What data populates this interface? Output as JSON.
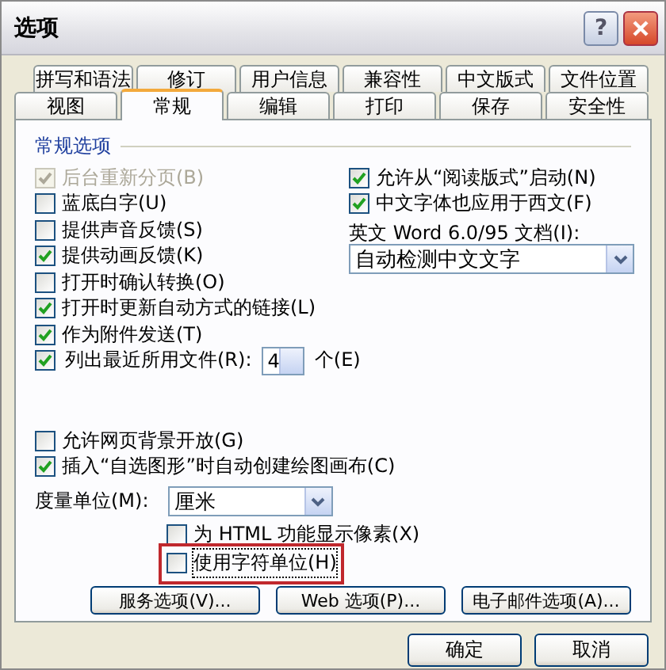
{
  "window": {
    "title": "选项",
    "help_button": "?"
  },
  "tab_rows": [
    [
      {
        "label": "拼写和语法",
        "selected": false
      },
      {
        "label": "修订",
        "selected": false
      },
      {
        "label": "用户信息",
        "selected": false
      },
      {
        "label": "兼容性",
        "selected": false
      },
      {
        "label": "中文版式",
        "selected": false
      },
      {
        "label": "文件位置",
        "selected": false
      }
    ],
    [
      {
        "label": "视图",
        "selected": false
      },
      {
        "label": "常规",
        "selected": true
      },
      {
        "label": "编辑",
        "selected": false
      },
      {
        "label": "打印",
        "selected": false
      },
      {
        "label": "保存",
        "selected": false
      },
      {
        "label": "安全性",
        "selected": false
      }
    ]
  ],
  "general": {
    "title": "常规选项",
    "left_options": [
      {
        "label": "后台重新分页(B)",
        "checked": true,
        "disabled": true
      },
      {
        "label": "蓝底白字(U)",
        "checked": false,
        "disabled": false
      },
      {
        "label": "提供声音反馈(S)",
        "checked": false,
        "disabled": false
      },
      {
        "label": "提供动画反馈(K)",
        "checked": true,
        "disabled": false
      },
      {
        "label": "打开时确认转换(O)",
        "checked": false,
        "disabled": false
      },
      {
        "label": "打开时更新自动方式的链接(L)",
        "checked": true,
        "disabled": false
      },
      {
        "label": "作为附件发送(T)",
        "checked": true,
        "disabled": false
      }
    ],
    "recent_files": {
      "checked": true,
      "label": "列出最近所用文件(R):",
      "value": "4",
      "unit": "个(E)"
    },
    "right_options": [
      {
        "label": "允许从“阅读版式”启动(N)",
        "checked": true
      },
      {
        "label": "中文字体也应用于西文(F)",
        "checked": true
      }
    ],
    "word95": {
      "label": "英文 Word 6.0/95 文档(I):",
      "value": "自动检测中文文字"
    },
    "lower_options": [
      {
        "label": "允许网页背景开放(G)",
        "checked": false
      },
      {
        "label": "插入“自选图形”时自动创建绘图画布(C)",
        "checked": true
      }
    ],
    "measure": {
      "label": "度量单位(M):",
      "value": "厘米"
    },
    "sub_options": [
      {
        "label": "为 HTML 功能显示像素(X)",
        "checked": false,
        "highlighted": false,
        "focused": false
      },
      {
        "label": "使用字符单位(H)",
        "checked": false,
        "highlighted": true,
        "focused": true
      }
    ]
  },
  "action_buttons": [
    {
      "label": "服务选项(V)..."
    },
    {
      "label": "Web 选项(P)..."
    },
    {
      "label": "电子邮件选项(A)..."
    }
  ],
  "footer_buttons": [
    {
      "label": "确定"
    },
    {
      "label": "取消"
    }
  ]
}
